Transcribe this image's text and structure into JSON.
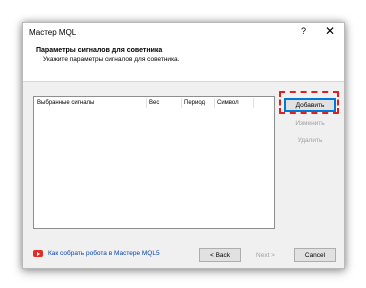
{
  "window": {
    "title": "Мастер MQL",
    "help_label": "?",
    "close_label": "✕"
  },
  "header": {
    "title": "Параметры сигналов для советника",
    "subtitle": "Укажите параметры сигналов для советника."
  },
  "signals_table": {
    "columns": [
      "Выбранные сигналы",
      "Вес",
      "Период",
      "Символ"
    ],
    "rows": []
  },
  "buttons": {
    "add": "Добавить",
    "edit": "Изменить",
    "delete": "Удалить",
    "back": "< Back",
    "next": "Next >",
    "cancel": "Cancel"
  },
  "footer": {
    "help_link": "Как собрать робота в Мастере MQL5",
    "icon": "youtube-play-icon"
  },
  "colors": {
    "highlight": "#e01f1f",
    "link": "#0645ad",
    "primary_border": "#0078d7"
  }
}
